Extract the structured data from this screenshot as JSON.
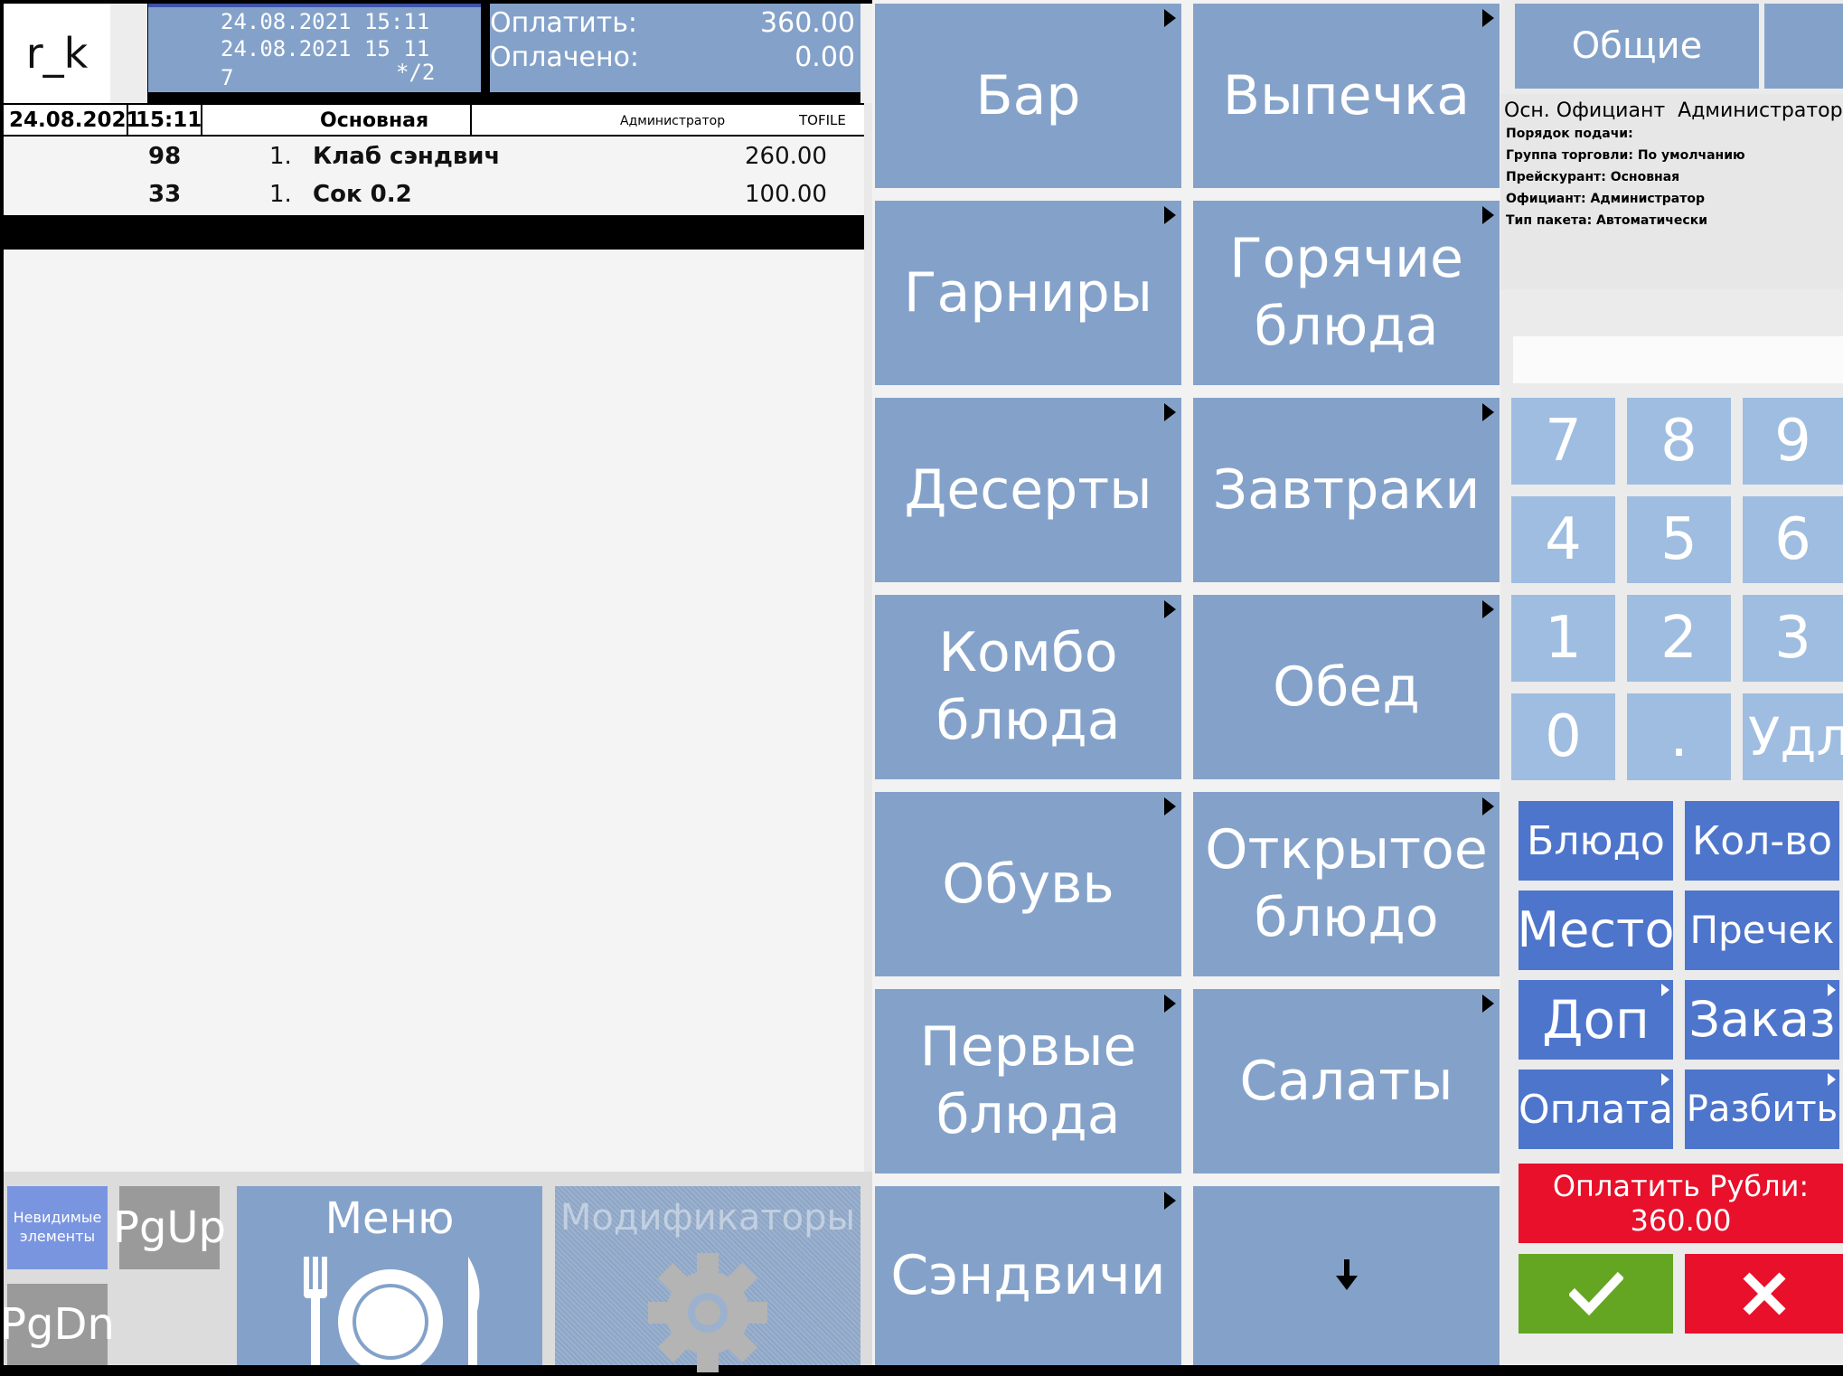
{
  "logo": "r_k",
  "header": {
    "date_open": "24.08.2021 15:11",
    "date_now": "24.08.2021 15 11",
    "guests": "7",
    "table": "*/2",
    "to_pay_label": "Оплатить:",
    "to_pay_value": "360.00",
    "paid_label": "Оплачено:",
    "paid_value": "0.00"
  },
  "order_header": {
    "date": "24.08.2021",
    "time": "15:11",
    "course": "Основная",
    "waiter": "Администратор",
    "source": "TOFILE"
  },
  "order_items": [
    {
      "code": "98",
      "qty": "1.",
      "name": "Клаб сэндвич",
      "price": "260.00"
    },
    {
      "code": "33",
      "qty": "1.",
      "name": "Сок 0.2",
      "price": "100.00"
    }
  ],
  "bottom_left": {
    "invisible": "Невидимые элементы",
    "pgup": "PgUp",
    "pgdn": "PgDn",
    "menu": "Меню",
    "modifiers": "Модификаторы"
  },
  "categories": [
    {
      "label": "Бар",
      "arrow": true
    },
    {
      "label": "Выпечка",
      "arrow": true
    },
    {
      "label": "Гарниры",
      "arrow": true
    },
    {
      "label": "Горячие блюда",
      "arrow": true
    },
    {
      "label": "Десерты",
      "arrow": true
    },
    {
      "label": "Завтраки",
      "arrow": true
    },
    {
      "label": "Комбо блюда",
      "arrow": true
    },
    {
      "label": "Обед",
      "arrow": true
    },
    {
      "label": "Обувь",
      "arrow": true
    },
    {
      "label": "Открытое блюдо",
      "arrow": true
    },
    {
      "label": "Первые блюда",
      "arrow": true
    },
    {
      "label": "Салаты",
      "arrow": true
    },
    {
      "label": "Сэндвичи",
      "arrow": true
    },
    {
      "label": "",
      "arrow": false
    }
  ],
  "right_panel": {
    "tab_general": "Общие",
    "waiter_line": "Осн. Официант  Администратор",
    "info_lines": [
      "Порядок подачи:",
      "Группа торговли: По умолчанию",
      "Прейскурант: Основная",
      "Официант: Администратор",
      "Тип пакета: Автоматически"
    ],
    "input_value": ""
  },
  "keypad": [
    "7",
    "8",
    "9",
    "4",
    "5",
    "6",
    "1",
    "2",
    "3",
    "0",
    ".",
    "Удл"
  ],
  "actions": [
    {
      "label": "Блюдо",
      "arrow": false
    },
    {
      "label": "Кол-во",
      "arrow": false
    },
    {
      "label": "Место",
      "arrow": false
    },
    {
      "label": "Пречек",
      "arrow": false
    },
    {
      "label": "Доп",
      "arrow": true
    },
    {
      "label": "Заказ",
      "arrow": true
    },
    {
      "label": "Оплата",
      "arrow": true
    },
    {
      "label": "Разбить",
      "arrow": true
    }
  ],
  "pay": {
    "label": "Оплатить Рубли:",
    "amount": "360.00"
  },
  "colors": {
    "tile": "#84A2C9",
    "keypad": "#9EBDE0",
    "action": "#4E75CC",
    "pay": "#E8102A",
    "ok": "#64A622",
    "cancel": "#E8102A"
  }
}
